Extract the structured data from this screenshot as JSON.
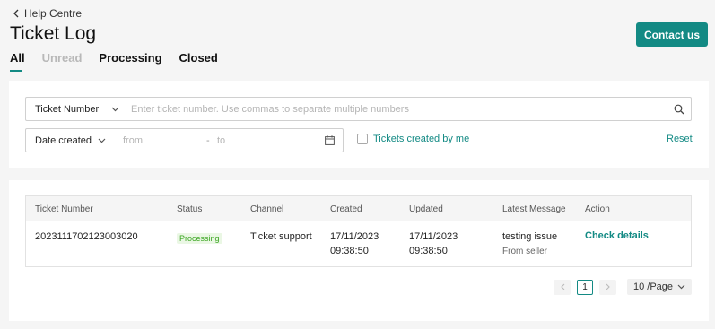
{
  "header": {
    "back_label": "Help Centre",
    "title": "Ticket Log",
    "contact_label": "Contact us"
  },
  "tabs": [
    {
      "label": "All",
      "state": "active"
    },
    {
      "label": "Unread",
      "state": "disabled"
    },
    {
      "label": "Processing",
      "state": "normal"
    },
    {
      "label": "Closed",
      "state": "normal"
    }
  ],
  "filters": {
    "search_type": "Ticket Number",
    "search_placeholder": "Enter ticket number. Use commas to separate multiple numbers",
    "search_icon": "search-icon",
    "date_type": "Date created",
    "date_from_placeholder": "from",
    "date_separator": "-",
    "date_to_placeholder": "to",
    "calendar_icon": "calendar-icon",
    "mine_label": "Tickets created by me",
    "mine_checked": false,
    "reset_label": "Reset"
  },
  "table": {
    "headers": {
      "ticket_number": "Ticket Number",
      "status": "Status",
      "channel": "Channel",
      "created": "Created",
      "updated": "Updated",
      "latest_message": "Latest Message",
      "action": "Action"
    },
    "rows": [
      {
        "ticket_number": "2023111702123003020",
        "status": "Processing",
        "channel": "Ticket support",
        "created_date": "17/11/2023",
        "created_time": "09:38:50",
        "updated_date": "17/11/2023",
        "updated_time": "09:38:50",
        "message": "testing issue",
        "message_from": "From seller",
        "action": "Check details"
      }
    ]
  },
  "pagination": {
    "current_page": "1",
    "page_size": "10 /Page"
  },
  "colors": {
    "accent": "#138a84",
    "processing_badge_bg": "#eaf7e4",
    "processing_badge_text": "#3aa521"
  }
}
